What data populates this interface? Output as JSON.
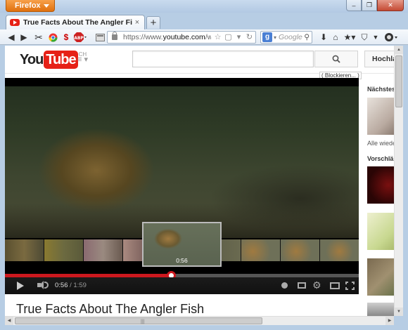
{
  "browser": {
    "menu_label": "Firefox",
    "tab_title": "True Facts About The Angler Fish - YouT...",
    "tab_close_glyph": "×",
    "new_tab_glyph": "+",
    "url_prefix": "https://www.",
    "url_domain": "youtube.com",
    "url_rest": "/w...",
    "search_engine_placeholder": "Google",
    "window_buttons": {
      "minimize": "–",
      "restore": "❐",
      "close": "✕"
    }
  },
  "youtube": {
    "logo_you": "You",
    "logo_tube": "Tube",
    "logo_country": "CH",
    "guide_glyph": "≡ ▾",
    "search_glyph": "⌕",
    "upload_label": "Hochladen",
    "block_label": "( Blockieren... )"
  },
  "player": {
    "preview_time": "0:56",
    "current_time": "0:56",
    "duration": "1:59",
    "time_separator": " / ",
    "progress_fraction": 0.47
  },
  "video": {
    "title": "True Facts About The Angler Fish"
  },
  "sidebar": {
    "next_label": "Nächstes",
    "replay_label": "Alle wiede",
    "suggestions_label": "Vorschlä"
  },
  "colors": {
    "youtube_red": "#e62117",
    "progress_red": "#cc181e",
    "firefox_orange": "#e0700e"
  }
}
